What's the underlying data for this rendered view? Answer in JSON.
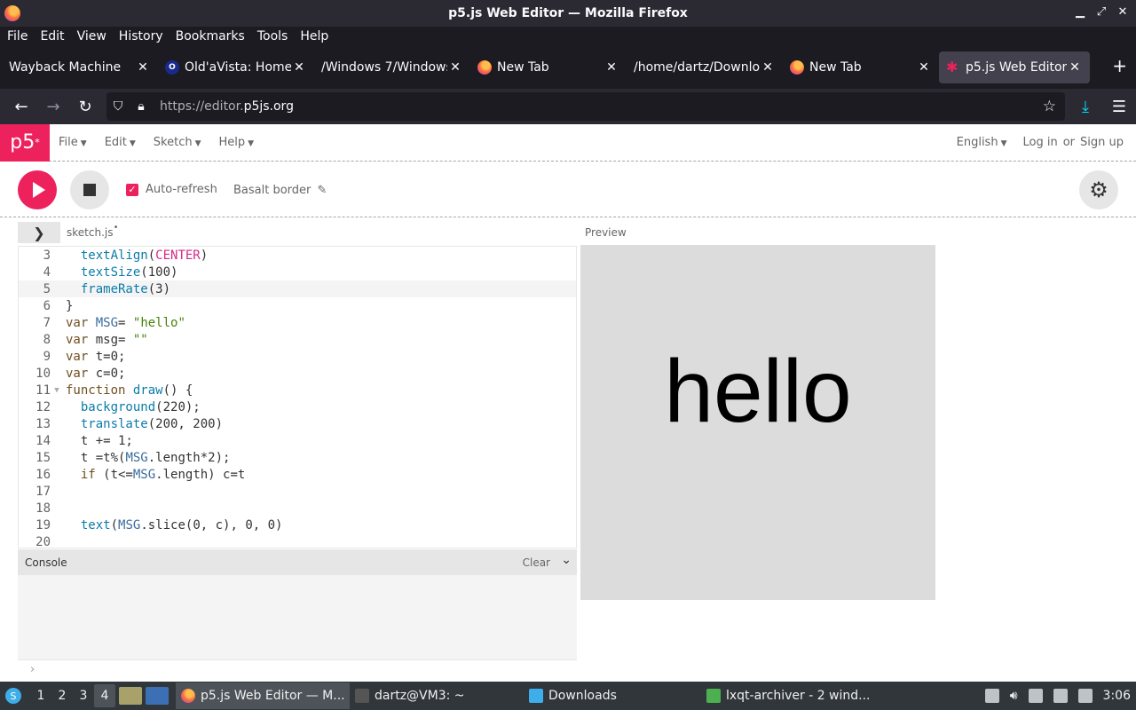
{
  "window": {
    "title": "p5.js Web Editor — Mozilla Firefox"
  },
  "menubar": {
    "items": [
      "File",
      "Edit",
      "View",
      "History",
      "Bookmarks",
      "Tools",
      "Help"
    ]
  },
  "tabs": [
    {
      "label": "Wayback Machine",
      "icon": "none"
    },
    {
      "label": "Old'aVista: Home",
      "icon": "oldavista"
    },
    {
      "label": "/Windows 7/Windows",
      "icon": "none"
    },
    {
      "label": "New Tab",
      "icon": "firefox"
    },
    {
      "label": "/home/dartz/Downloa",
      "icon": "none"
    },
    {
      "label": "New Tab",
      "icon": "firefox"
    },
    {
      "label": "p5.js Web Editor",
      "icon": "p5",
      "active": true
    }
  ],
  "navbar": {
    "url_prefix": "https://editor.",
    "url_host": "p5js.org"
  },
  "p5nav": {
    "logo": "p5",
    "menu": [
      "File",
      "Edit",
      "Sketch",
      "Help"
    ],
    "language": "English",
    "login": "Log in",
    "or": "or",
    "signup": "Sign up"
  },
  "toolbar": {
    "autorefresh_label": "Auto-refresh",
    "autorefresh_checked": true,
    "sketch_name": "Basalt border"
  },
  "editor": {
    "filename": "sketch.js",
    "unsaved_dot": "•",
    "lines": [
      {
        "n": "3",
        "text": "  textAlign(CENTER)"
      },
      {
        "n": "4",
        "text": "  textSize(100)"
      },
      {
        "n": "5",
        "text": "  frameRate(3)"
      },
      {
        "n": "6",
        "text": "}"
      },
      {
        "n": "7",
        "text": "var MSG= \"hello\""
      },
      {
        "n": "8",
        "text": "var msg= \"\""
      },
      {
        "n": "9",
        "text": "var t=0;"
      },
      {
        "n": "10",
        "text": "var c=0;"
      },
      {
        "n": "11",
        "text": "function draw() {"
      },
      {
        "n": "12",
        "text": "  background(220);"
      },
      {
        "n": "13",
        "text": "  translate(200, 200)"
      },
      {
        "n": "14",
        "text": "  t += 1;"
      },
      {
        "n": "15",
        "text": "  t =t%(MSG.length*2);"
      },
      {
        "n": "16",
        "text": "  if (t<=MSG.length) c=t"
      },
      {
        "n": "17",
        "text": ""
      },
      {
        "n": "18",
        "text": ""
      },
      {
        "n": "19",
        "text": "  text(MSG.slice(0, c), 0, 0)"
      },
      {
        "n": "20",
        "text": ""
      }
    ]
  },
  "console": {
    "title": "Console",
    "clear": "Clear",
    "prompt": "›"
  },
  "preview": {
    "label": "Preview",
    "canvas_text": "hello"
  },
  "taskbar": {
    "desktops": [
      "1",
      "2",
      "3",
      "4"
    ],
    "tasks": [
      "p5.js Web Editor — M...",
      "dartz@VM3: ~",
      "Downloads",
      "lxqt-archiver - 2 wind..."
    ],
    "clock": "3:06"
  }
}
